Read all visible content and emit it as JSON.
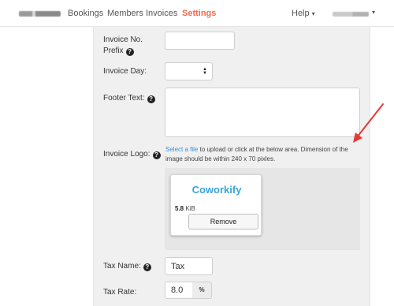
{
  "nav": {
    "items": [
      {
        "label": "Bookings"
      },
      {
        "label": "Members"
      },
      {
        "label": "Invoices"
      },
      {
        "label": "Settings",
        "active": true
      }
    ],
    "help_label": "Help",
    "active_color": "#f36b4f"
  },
  "form": {
    "invoice_no_prefix": {
      "label_line1": "Invoice No.",
      "label_line2": "Prefix",
      "value": ""
    },
    "invoice_day": {
      "label": "Invoice Day:",
      "value": ""
    },
    "footer_text": {
      "label": "Footer Text:",
      "value": ""
    },
    "invoice_logo": {
      "label": "Invoice Logo:",
      "help_link": "Select a file",
      "help_text": " to upload or click at the below area. Dimension of the image should be within 240 x 70 pixles.",
      "preview_logo_text": "Coworkify",
      "file_size_value": "5.8",
      "file_size_unit": " KiB",
      "remove_label": "Remove"
    },
    "tax_name": {
      "label": "Tax Name:",
      "value": "Tax"
    },
    "tax_rate": {
      "label": "Tax Rate:",
      "value": "8.0",
      "addon": "%"
    }
  },
  "icons": {
    "help": "question-circle-icon",
    "select_arrows": "sort-icon",
    "annotation": "red-arrow-icon"
  },
  "colors": {
    "link": "#3a8fd6",
    "logo": "#3aa3d8",
    "annotation_arrow": "#e53935"
  }
}
